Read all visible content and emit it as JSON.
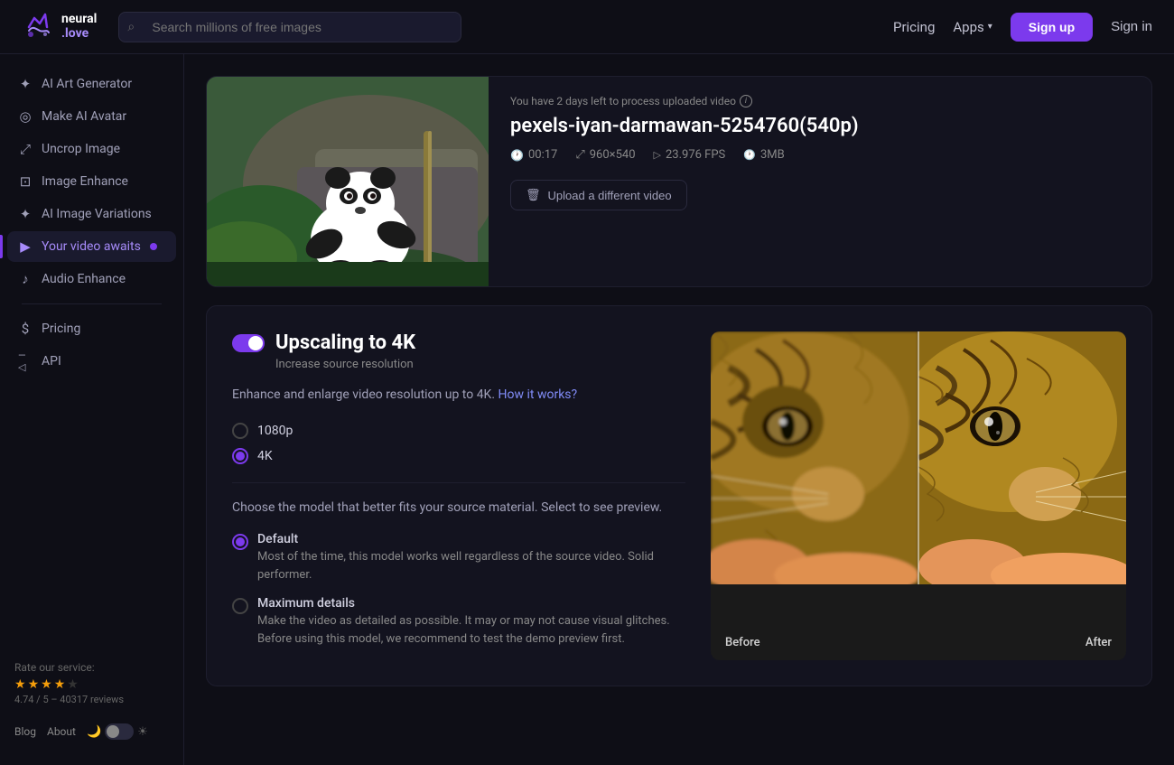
{
  "header": {
    "logo_text": "neural\n.love",
    "search_placeholder": "Search millions of free images",
    "pricing_label": "Pricing",
    "apps_label": "Apps",
    "signup_label": "Sign up",
    "signin_label": "Sign in"
  },
  "sidebar": {
    "items": [
      {
        "id": "ai-art-generator",
        "label": "AI Art Generator",
        "icon": "✦"
      },
      {
        "id": "make-ai-avatar",
        "label": "Make AI Avatar",
        "icon": "◎"
      },
      {
        "id": "uncrop-image",
        "label": "Uncrop Image",
        "icon": "⤢"
      },
      {
        "id": "image-enhance",
        "label": "Image Enhance",
        "icon": "⊞"
      },
      {
        "id": "ai-image-variations",
        "label": "AI Image Variations",
        "icon": "✦"
      },
      {
        "id": "your-video-awaits",
        "label": "Your video awaits",
        "icon": "▶",
        "active": true
      },
      {
        "id": "audio-enhance",
        "label": "Audio Enhance",
        "icon": "♪"
      }
    ],
    "bottom_items": [
      {
        "id": "pricing",
        "label": "Pricing",
        "icon": "$"
      },
      {
        "id": "api",
        "label": "API",
        "icon": "—"
      }
    ],
    "rate_label": "Rate our service:",
    "stars_count": 5,
    "filled_stars": 4,
    "rating": "4.74 / 5 – 40317 reviews",
    "footer_links": [
      "Blog",
      "About"
    ],
    "theme_moon": "🌙",
    "theme_sun": "☀"
  },
  "video_section": {
    "notice": "You have 2 days left to process uploaded video",
    "video_title": "pexels-iyan-darmawan-5254760(540p)",
    "meta": [
      {
        "icon": "clock",
        "value": "00:17"
      },
      {
        "icon": "resolution",
        "value": "960×540"
      },
      {
        "icon": "fps",
        "value": "23.976 FPS"
      },
      {
        "icon": "size",
        "value": "3MB"
      }
    ],
    "upload_btn_label": "Upload a different video"
  },
  "upscale_section": {
    "title": "Upscaling to 4K",
    "subtitle": "Increase source resolution",
    "description_prefix": "Enhance and enlarge video resolution up to 4K.",
    "how_it_works": "How it works?",
    "resolution_options": [
      {
        "id": "1080p",
        "label": "1080p",
        "selected": false
      },
      {
        "id": "4k",
        "label": "4K",
        "selected": true
      }
    ],
    "choose_model_text": "Choose the model that better fits your source material. Select to see preview.",
    "models": [
      {
        "id": "default",
        "label": "Default",
        "description": "Most of the time, this model works well regardless of the source video. Solid performer.",
        "selected": true
      },
      {
        "id": "maximum-details",
        "label": "Maximum details",
        "description": "Make the video as detailed as possible. It may or may not cause visual glitches. Before using this model, we recommend to test the demo preview first.",
        "selected": false
      }
    ],
    "before_label": "Before",
    "after_label": "After"
  }
}
